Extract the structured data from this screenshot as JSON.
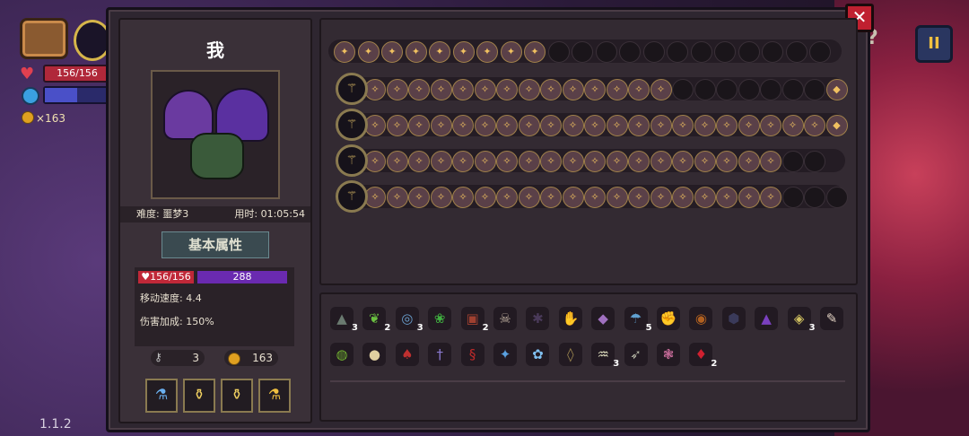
{
  "hud": {
    "hp_text": "156/156",
    "coins": "×163",
    "mp_level": 0.5,
    "version": "1.1.2",
    "help_label": "?",
    "pause_label": "II",
    "close_label": "✕"
  },
  "character": {
    "name": "我",
    "difficulty": "难度: 噩梦3",
    "time": "用时: 01:05:54",
    "section_title": "基本属性",
    "hp": "156/156",
    "mp": "288",
    "move_speed": "移动速度: 4.4",
    "damage_bonus": "伤害加成: 150%",
    "keys": "3",
    "coins": "163",
    "potion_slots": [
      "potion-blue",
      "potion-gold",
      "potion-gold",
      "potion-blue-gold"
    ]
  },
  "weapons": {
    "row0_icons": [
      "chest",
      "swirl",
      "arrows",
      "star",
      "fire",
      "fire",
      "fist",
      "fist",
      "target"
    ],
    "row0_empty_count": 12,
    "rows": [
      {
        "weapon": "staff-gold",
        "filled": 14,
        "empty": 7,
        "end_icon": "blue-orb"
      },
      {
        "weapon": "crystal-purple",
        "filled": 21,
        "empty": 0,
        "end_icon": "star-arrow"
      },
      {
        "weapon": "staff-green",
        "filled": 19,
        "empty": 2,
        "end_icon": ""
      },
      {
        "weapon": "staff-gold-2",
        "filled": 19,
        "empty": 3,
        "end_icon": ""
      }
    ]
  },
  "items": {
    "row1": [
      {
        "icon": "cloak-icon",
        "glyph": "▲",
        "color": "#6a7a70",
        "count": "3"
      },
      {
        "icon": "leaf-icon",
        "glyph": "❦",
        "color": "#6ac040",
        "count": "2"
      },
      {
        "icon": "magnifier-icon",
        "glyph": "◎",
        "color": "#6aa0d0",
        "count": "3"
      },
      {
        "icon": "plant-icon",
        "glyph": "❀",
        "color": "#40b040",
        "count": ""
      },
      {
        "icon": "crate-icon",
        "glyph": "▣",
        "color": "#a04030",
        "count": "2"
      },
      {
        "icon": "skull-icon",
        "glyph": "☠",
        "color": "#c0b0a0",
        "count": ""
      },
      {
        "icon": "bug-icon",
        "glyph": "✱",
        "color": "#4a3a5a",
        "count": ""
      },
      {
        "icon": "glove-icon",
        "glyph": "✋",
        "color": "#5a4aa0",
        "count": ""
      },
      {
        "icon": "map-icon",
        "glyph": "◆",
        "color": "#a070c0",
        "count": ""
      },
      {
        "icon": "mushroom-icon",
        "glyph": "☂",
        "color": "#60a0d0",
        "count": "5"
      },
      {
        "icon": "gauntlet-icon",
        "glyph": "✊",
        "color": "#d0a030",
        "count": ""
      },
      {
        "icon": "barrel-icon",
        "glyph": "◉",
        "color": "#b06020",
        "count": ""
      },
      {
        "icon": "shield-icon",
        "glyph": "⬢",
        "color": "#3a3a5a",
        "count": ""
      },
      {
        "icon": "witch-hat-icon",
        "glyph": "▲",
        "color": "#7a40c0",
        "count": ""
      },
      {
        "icon": "amulet-icon",
        "glyph": "◈",
        "color": "#d0c060",
        "count": "3"
      },
      {
        "icon": "feather-icon",
        "glyph": "✎",
        "color": "#e0d0c0",
        "count": ""
      }
    ],
    "row2": [
      {
        "icon": "ring-icon",
        "glyph": "◍",
        "color": "#70b030",
        "count": ""
      },
      {
        "icon": "dumpling-icon",
        "glyph": "●",
        "color": "#e0d0a0",
        "count": ""
      },
      {
        "icon": "bird-icon",
        "glyph": "♠",
        "color": "#c03030",
        "count": ""
      },
      {
        "icon": "dagger-icon",
        "glyph": "†",
        "color": "#8a7ad0",
        "count": ""
      },
      {
        "icon": "serpent-icon",
        "glyph": "§",
        "color": "#c02a2a",
        "count": ""
      },
      {
        "icon": "crystal-icon",
        "glyph": "✦",
        "color": "#5aa0e0",
        "count": ""
      },
      {
        "icon": "lotus-icon",
        "glyph": "✿",
        "color": "#80c0f0",
        "count": ""
      },
      {
        "icon": "lantern-icon",
        "glyph": "◊",
        "color": "#a08a50",
        "count": ""
      },
      {
        "icon": "teeth-icon",
        "glyph": "♒",
        "color": "#e0e0c0",
        "count": "3"
      },
      {
        "icon": "arrow-icon",
        "glyph": "➶",
        "color": "#b0b0a0",
        "count": ""
      },
      {
        "icon": "brain-icon",
        "glyph": "❃",
        "color": "#d070a0",
        "count": ""
      },
      {
        "icon": "demon-icon",
        "glyph": "♦",
        "color": "#d02030",
        "count": "2"
      }
    ]
  }
}
